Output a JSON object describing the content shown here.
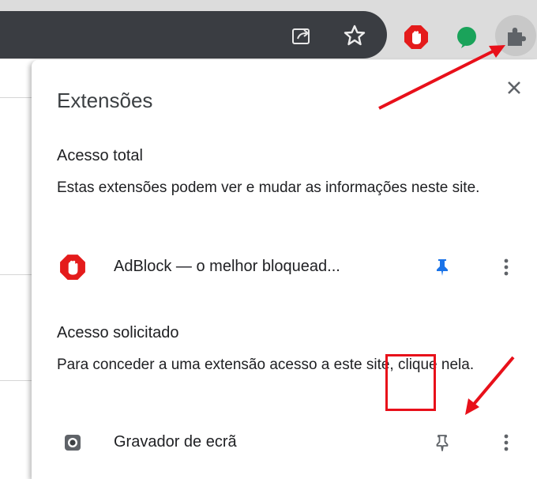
{
  "toolbar": {
    "icons": [
      "share-icon",
      "star-icon",
      "adblock-extension-icon",
      "green-extension-icon",
      "puzzle-extensions-icon"
    ]
  },
  "popup": {
    "title": "Extensões",
    "close_icon": "close-icon",
    "sections": [
      {
        "title": "Acesso total",
        "description": "Estas extensões podem ver e mudar as informações neste site.",
        "extensions": [
          {
            "name": "AdBlock — o melhor bloquead...",
            "icon": "adblock-icon",
            "pinned": true
          }
        ]
      },
      {
        "title": "Acesso solicitado",
        "description": "Para conceder a uma extensão acesso a este site, clique nela.",
        "extensions": [
          {
            "name": "Gravador de ecrã",
            "icon": "screen-recorder-icon",
            "pinned": false
          }
        ]
      }
    ]
  },
  "colors": {
    "annotation_red": "#e8101a",
    "pin_blue": "#1a73e8",
    "adblock_red": "#e41b1b",
    "extension_green": "#1aa35a"
  }
}
